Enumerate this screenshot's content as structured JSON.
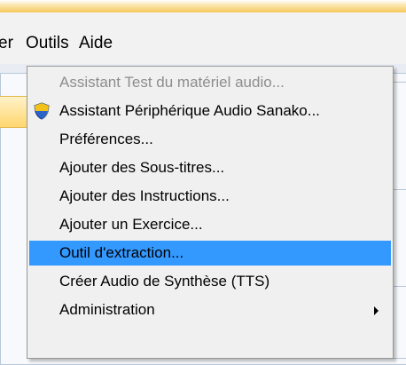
{
  "menubar": {
    "items": [
      "er",
      "Outils",
      "Aide"
    ]
  },
  "menu": {
    "items": [
      {
        "label": "Assistant Test du matériel audio...",
        "state": "disabled"
      },
      {
        "label": "Assistant Périphérique Audio Sanako...",
        "icon": "shield-icon"
      },
      {
        "label": "Préférences..."
      },
      {
        "label": "Ajouter des Sous-titres..."
      },
      {
        "label": "Ajouter des Instructions..."
      },
      {
        "label": "Ajouter un Exercice..."
      },
      {
        "label": "Outil d'extraction...",
        "state": "highlighted"
      },
      {
        "label": "Créer Audio de Synthèse (TTS)"
      },
      {
        "label": "Administration",
        "has_submenu": true
      }
    ]
  },
  "colors": {
    "highlight": "#3399ff",
    "menu_bg": "#f0f0f0",
    "disabled_text": "#8d8d8d"
  }
}
